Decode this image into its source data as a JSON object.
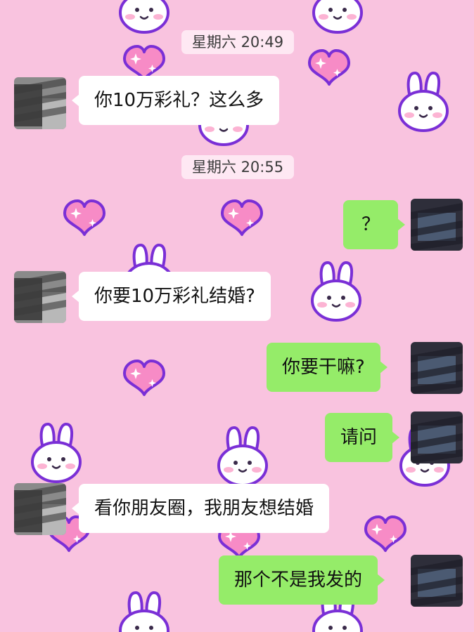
{
  "colors": {
    "background": "#f9c3df",
    "incoming_bubble": "#ffffff",
    "outgoing_bubble": "#95ec69",
    "sticker_outline": "#7a2fd6",
    "heart_fill": "#f78bc6"
  },
  "chat": {
    "timestamps": [
      "星期六 20:49",
      "星期六 20:55"
    ],
    "messages": [
      {
        "side": "incoming",
        "text": "你10万彩礼？这么多"
      },
      {
        "side": "outgoing",
        "text": "？"
      },
      {
        "side": "incoming",
        "text": "你要10万彩礼结婚?"
      },
      {
        "side": "outgoing",
        "text": "你要干嘛?"
      },
      {
        "side": "outgoing",
        "text": "请问"
      },
      {
        "side": "incoming",
        "text": "看你朋友圈，我朋友想结婚"
      },
      {
        "side": "outgoing",
        "text": "那个不是我发的"
      }
    ]
  },
  "icons": {
    "incoming_avatar": "blurred-avatar-icon",
    "outgoing_avatar": "blurred-avatar-icon",
    "wallpaper_stickers": [
      "bunny-icon",
      "heart-icon"
    ]
  }
}
